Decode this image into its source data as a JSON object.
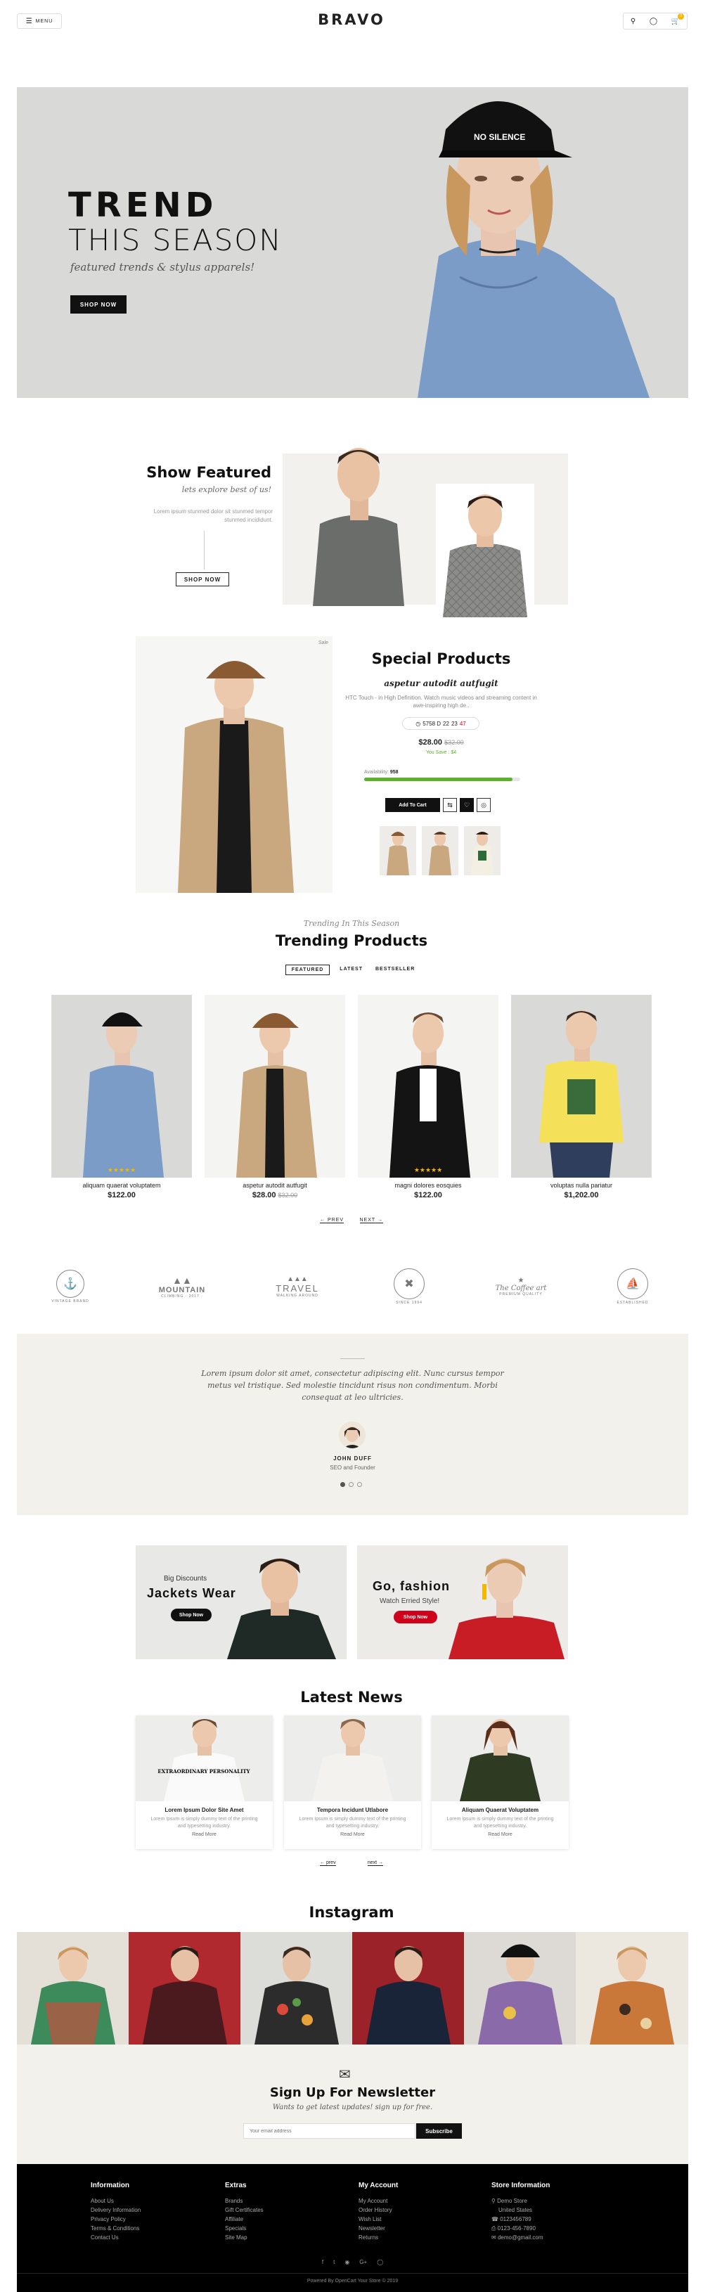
{
  "header": {
    "menu_label": "MENU",
    "logo": "BRAVO",
    "cart_count": "0"
  },
  "hero": {
    "line1": "TREND",
    "line2": "THIS SEASON",
    "tagline": "featured trends & stylus apparels!",
    "button": "SHOP NOW",
    "cap_text": "NO SILENCE"
  },
  "featured": {
    "title": "Show Featured",
    "subtitle": "lets explore best of us!",
    "body": "Lorem ipsum stunmed dolor sit stunmed tempor stunmed incididunt.",
    "button": "SHOP NOW"
  },
  "special": {
    "tag": "Sale",
    "title": "Special Products",
    "product_name": "aspetur autodit autfugit",
    "description": "HTC Touch - in High Definition. Watch music videos and streaming content in awe-inspiring high de..",
    "timer": [
      "5758 D",
      "22",
      "23",
      "47"
    ],
    "price": "$28.00",
    "old_price": "$32.00",
    "savings": "You Save : $4",
    "availability_label": "Availability:",
    "availability_value": "958",
    "availability_fraction": 0.95,
    "add_to_cart": "Add To Cart"
  },
  "trending": {
    "kicker": "Trending In This Season",
    "title": "Trending Products",
    "tabs": [
      "FEATURED",
      "LATEST",
      "BESTSELLER"
    ],
    "products": [
      {
        "name": "aliquam quaerat voluptatem",
        "price": "$122.00",
        "old_price": "",
        "rating": 5
      },
      {
        "name": "aspetur autodit autfugit",
        "price": "$28.00",
        "old_price": "$32.00",
        "rating": 0
      },
      {
        "name": "magni dolores eosquies",
        "price": "$122.00",
        "old_price": "",
        "rating": 5
      },
      {
        "name": "voluptas nulla pariatur",
        "price": "$1,202.00",
        "old_price": "",
        "rating": 0
      }
    ],
    "prev": "PREV",
    "next": "NEXT"
  },
  "brands": [
    {
      "top": "",
      "main": "",
      "bottom": "VINTAGE BRAND"
    },
    {
      "top": "",
      "main": "MOUNTAIN",
      "bottom": "CLIMBING · 2017 ·"
    },
    {
      "top": "",
      "main": "TRAVEL",
      "bottom": "WALKING AROUND"
    },
    {
      "top": "",
      "main": "",
      "bottom": "SINCE 1994"
    },
    {
      "top": "The Coffee art",
      "main": "",
      "bottom": "PREMIUM QUALITY"
    },
    {
      "top": "",
      "main": "",
      "bottom": "ESTABLISHED"
    }
  ],
  "testimonial": {
    "quote": "Lorem ipsum dolor sit amet, consectetur adipiscing elit. Nunc cursus tempor metus vel tristique. Sed molestie tincidunt risus non condimentum. Morbi consequat at leo ultricies.",
    "name": "JOHN DUFF",
    "role": "SEO and Founder"
  },
  "banners": [
    {
      "kicker": "Big Discounts",
      "title": "Jackets Wear",
      "button": "Shop Now"
    },
    {
      "kicker": "",
      "title": "Go, fashion",
      "subtitle": "Watch Erried Style!",
      "button": "Shop Now"
    }
  ],
  "news": {
    "title": "Latest News",
    "posts": [
      {
        "title": "Lorem Ipsum Dolor Site Amet",
        "excerpt": "Lorem Ipsum is simply dummy text of the printing and typesetting industry.",
        "more": "Read More",
        "shirt_text": "EXTRAORDINARY PERSONALITY"
      },
      {
        "title": "Tempora Incidunt Utlabore",
        "excerpt": "Lorem Ipsum is simply dummy text of the printing and typesetting industry.",
        "more": "Read More"
      },
      {
        "title": "Aliquam Quaerat Voluptatem",
        "excerpt": "Lorem Ipsum is simply dummy text of the printing and typesetting industry.",
        "more": "Read More"
      }
    ],
    "prev": "prev",
    "next": "next"
  },
  "instagram": {
    "title": "Instagram"
  },
  "newsletter": {
    "title": "Sign Up For Newsletter",
    "subtitle": "Wants to get latest updates! sign up for free.",
    "placeholder": "Your email address",
    "button": "Subscribe"
  },
  "footer": {
    "columns": [
      {
        "title": "Information",
        "links": [
          "About Us",
          "Delivery Information",
          "Privacy Policy",
          "Terms & Conditions",
          "Contact Us"
        ]
      },
      {
        "title": "Extras",
        "links": [
          "Brands",
          "Gift Certificates",
          "Affiliate",
          "Specials",
          "Site Map"
        ]
      },
      {
        "title": "My Account",
        "links": [
          "My Account",
          "Order History",
          "Wish List",
          "Newsletter",
          "Returns"
        ]
      },
      {
        "title": "Store Information",
        "links": [
          "Demo Store",
          "United States",
          "0123456789",
          "0123-456-7890",
          "demo@gmail.com"
        ]
      }
    ],
    "powered": "Powered By OpenCart Your Store © 2019"
  },
  "colors": {
    "accent_red": "#d0021b",
    "progress_green": "#5cb02c",
    "dark": "#111111",
    "light_bg": "#f3f1ec"
  }
}
